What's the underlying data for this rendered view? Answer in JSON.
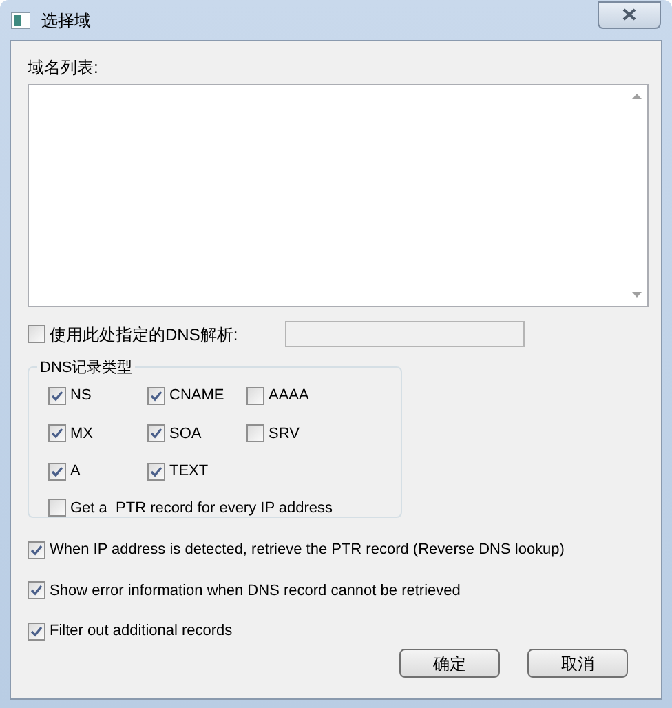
{
  "window": {
    "title": "选择域"
  },
  "domain_list": {
    "label": "域名列表:"
  },
  "custom_dns": {
    "label": "使用此处指定的DNS解析:",
    "checked": false
  },
  "record_types": {
    "title": "DNS记录类型",
    "items": [
      {
        "label": "NS",
        "checked": true
      },
      {
        "label": "CNAME",
        "checked": true
      },
      {
        "label": "AAAA",
        "checked": false
      },
      {
        "label": "MX",
        "checked": true
      },
      {
        "label": "SOA",
        "checked": true
      },
      {
        "label": "SRV",
        "checked": false
      },
      {
        "label": "A",
        "checked": true
      },
      {
        "label": "TEXT",
        "checked": true
      }
    ],
    "ptr_every": {
      "label": "Get a  PTR record for every IP address",
      "checked": false
    }
  },
  "options": [
    {
      "label": "When IP address is detected, retrieve the PTR record (Reverse DNS lookup)",
      "checked": true
    },
    {
      "label": "Show error information when DNS record cannot be retrieved",
      "checked": true
    },
    {
      "label": "Filter out additional records",
      "checked": true
    }
  ],
  "buttons": [
    "确定",
    "取消"
  ]
}
